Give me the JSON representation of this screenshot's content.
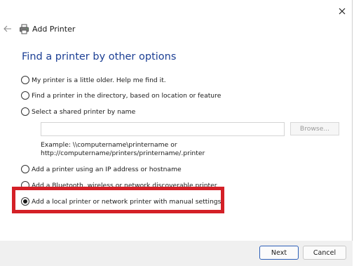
{
  "window": {
    "title": "Add Printer"
  },
  "heading": "Find a printer by other options",
  "options": [
    {
      "label": "My printer is a little older. Help me find it.",
      "checked": false
    },
    {
      "label": "Find a printer in the directory, based on location or feature",
      "checked": false
    },
    {
      "label": "Select a shared printer by name",
      "checked": false
    },
    {
      "label": "Add a printer using an IP address or hostname",
      "checked": false
    },
    {
      "label": "Add a Bluetooth, wireless or network discoverable printer",
      "checked": false
    },
    {
      "label": "Add a local printer or network printer with manual settings",
      "checked": true
    }
  ],
  "shared_printer": {
    "value": "",
    "browse_label": "Browse...",
    "example_line1": "Example: \\\\computername\\printername or",
    "example_line2": "http://computername/printers/printername/.printer"
  },
  "buttons": {
    "next": "Next",
    "cancel": "Cancel"
  },
  "colors": {
    "heading": "#1c3f94",
    "highlight": "#d42027",
    "default_button_border": "#2d5fb8"
  },
  "icons": {
    "close": "close-icon",
    "back": "back-arrow-icon",
    "printer": "printer-icon"
  }
}
